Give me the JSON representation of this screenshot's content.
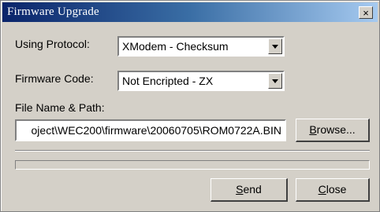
{
  "window": {
    "title": "Firmware Upgrade",
    "close_label": "×"
  },
  "form": {
    "protocol_label": "Using Protocol:",
    "protocol_value": "XModem - Checksum",
    "code_label": "Firmware Code:",
    "code_value": "Not Encripted - ZX",
    "path_label": "File Name & Path:",
    "path_value": "oject\\WEC200\\firmware\\20060705\\ROM0722A.BIN"
  },
  "buttons": {
    "browse_prefix": "B",
    "browse_rest": "rowse...",
    "send_prefix": "S",
    "send_rest": "end",
    "close_prefix": "C",
    "close_rest": "lose"
  },
  "progress": {
    "value": 0
  }
}
